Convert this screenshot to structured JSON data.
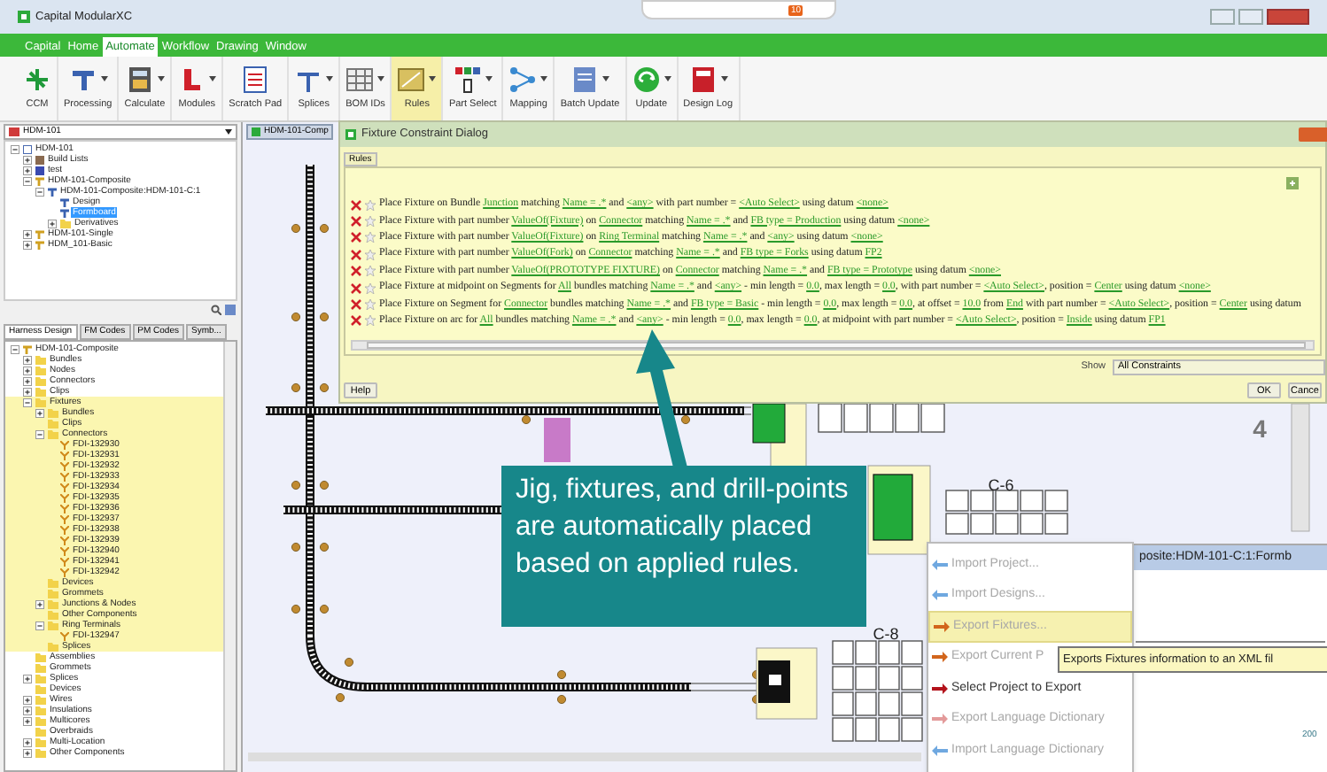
{
  "window": {
    "title": "Capital ModularXC",
    "badge": "10"
  },
  "menu": [
    {
      "label": "Capital",
      "selected": false
    },
    {
      "label": "Home",
      "selected": false
    },
    {
      "label": "Automate",
      "selected": true
    },
    {
      "label": "Workflow",
      "selected": false
    },
    {
      "label": "Drawing",
      "selected": false
    },
    {
      "label": "Window",
      "selected": false
    }
  ],
  "ribbon": [
    {
      "label": "CCM",
      "dropdown": false,
      "selected": false
    },
    {
      "label": "Processing",
      "dropdown": true,
      "selected": false
    },
    {
      "label": "Calculate",
      "dropdown": true,
      "selected": false
    },
    {
      "label": "Modules",
      "dropdown": true,
      "selected": false
    },
    {
      "label": "Scratch Pad",
      "dropdown": false,
      "selected": false
    },
    {
      "label": "Splices",
      "dropdown": true,
      "selected": false
    },
    {
      "label": "BOM IDs",
      "dropdown": true,
      "selected": false
    },
    {
      "label": "Rules",
      "dropdown": true,
      "selected": true
    },
    {
      "label": "Part Select",
      "dropdown": true,
      "selected": false
    },
    {
      "label": "Mapping",
      "dropdown": true,
      "selected": false
    },
    {
      "label": "Batch Update",
      "dropdown": true,
      "selected": false
    },
    {
      "label": "Update",
      "dropdown": true,
      "selected": false
    },
    {
      "label": "Design Log",
      "dropdown": true,
      "selected": false
    }
  ],
  "left_panel": {
    "dropdown": "HDM-101",
    "project_tree": [
      {
        "label": "HDM-101",
        "kind": "project",
        "expanded": true,
        "selected": false,
        "children": [
          {
            "label": "Build Lists",
            "kind": "list",
            "expanded": false,
            "selected": false
          },
          {
            "label": "test",
            "kind": "test",
            "expanded": false,
            "selected": false
          },
          {
            "label": "HDM-101-Composite",
            "kind": "harness",
            "expanded": true,
            "selected": false,
            "children": [
              {
                "label": "HDM-101-Composite:HDM-101-C:1",
                "kind": "design",
                "expanded": true,
                "selected": false,
                "children": [
                  {
                    "label": "Design",
                    "kind": "design",
                    "selected": false
                  },
                  {
                    "label": "Formboard",
                    "kind": "design",
                    "selected": true
                  },
                  {
                    "label": "Derivatives",
                    "kind": "folder",
                    "expanded": false,
                    "selected": false
                  }
                ]
              }
            ]
          },
          {
            "label": "HDM-101-Single",
            "kind": "harness",
            "expanded": false,
            "selected": false
          },
          {
            "label": "HDM_101-Basic",
            "kind": "harness",
            "expanded": false,
            "selected": false
          }
        ]
      }
    ],
    "tabs": [
      {
        "label": "Harness Design",
        "selected": true
      },
      {
        "label": "FM Codes",
        "selected": false
      },
      {
        "label": "PM Codes",
        "selected": false
      },
      {
        "label": "Symb...",
        "selected": false
      }
    ],
    "design_tree": [
      {
        "label": "HDM-101-Composite",
        "kind": "harness",
        "expanded": true,
        "highlighted": false,
        "children": [
          {
            "label": "Bundles",
            "kind": "folder",
            "expanded": false,
            "highlighted": false
          },
          {
            "label": "Nodes",
            "kind": "folder",
            "expanded": false,
            "highlighted": false
          },
          {
            "label": "Connectors",
            "kind": "folder",
            "expanded": false,
            "highlighted": false
          },
          {
            "label": "Clips",
            "kind": "folder",
            "expanded": false,
            "highlighted": false
          },
          {
            "label": "Fixtures",
            "kind": "folder",
            "expanded": true,
            "highlighted": true,
            "children": [
              {
                "label": "Bundles",
                "kind": "folder",
                "expanded": false
              },
              {
                "label": "Clips",
                "kind": "folder"
              },
              {
                "label": "Connectors",
                "kind": "folder",
                "expanded": true,
                "children": [
                  {
                    "label": "FDI-132930",
                    "kind": "fixture"
                  },
                  {
                    "label": "FDI-132931",
                    "kind": "fixture"
                  },
                  {
                    "label": "FDI-132932",
                    "kind": "fixture"
                  },
                  {
                    "label": "FDI-132933",
                    "kind": "fixture"
                  },
                  {
                    "label": "FDI-132934",
                    "kind": "fixture"
                  },
                  {
                    "label": "FDI-132935",
                    "kind": "fixture"
                  },
                  {
                    "label": "FDI-132936",
                    "kind": "fixture"
                  },
                  {
                    "label": "FDI-132937",
                    "kind": "fixture"
                  },
                  {
                    "label": "FDI-132938",
                    "kind": "fixture"
                  },
                  {
                    "label": "FDI-132939",
                    "kind": "fixture"
                  },
                  {
                    "label": "FDI-132940",
                    "kind": "fixture"
                  },
                  {
                    "label": "FDI-132941",
                    "kind": "fixture"
                  },
                  {
                    "label": "FDI-132942",
                    "kind": "fixture"
                  }
                ]
              },
              {
                "label": "Devices",
                "kind": "folder"
              },
              {
                "label": "Grommets",
                "kind": "folder"
              },
              {
                "label": "Junctions & Nodes",
                "kind": "folder",
                "expanded": false
              },
              {
                "label": "Other Components",
                "kind": "folder"
              },
              {
                "label": "Ring Terminals",
                "kind": "folder",
                "expanded": true,
                "children": [
                  {
                    "label": "FDI-132947",
                    "kind": "fixture"
                  }
                ]
              },
              {
                "label": "Splices",
                "kind": "folder"
              }
            ]
          },
          {
            "label": "Assemblies",
            "kind": "folder",
            "highlighted": false
          },
          {
            "label": "Grommets",
            "kind": "folder",
            "highlighted": false
          },
          {
            "label": "Splices",
            "kind": "folder",
            "expanded": false,
            "highlighted": false
          },
          {
            "label": "Devices",
            "kind": "folder",
            "highlighted": false
          },
          {
            "label": "Wires",
            "kind": "folder",
            "expanded": false,
            "highlighted": false
          },
          {
            "label": "Insulations",
            "kind": "folder",
            "expanded": false,
            "highlighted": false
          },
          {
            "label": "Multicores",
            "kind": "folder",
            "expanded": false,
            "highlighted": false
          },
          {
            "label": "Overbraids",
            "kind": "folder",
            "highlighted": false
          },
          {
            "label": "Multi-Location",
            "kind": "folder",
            "expanded": false,
            "highlighted": false
          },
          {
            "label": "Other Components",
            "kind": "folder",
            "expanded": false,
            "highlighted": false
          }
        ]
      }
    ]
  },
  "canvas": {
    "tab": "HDM-101-Comp",
    "labels": [
      "C-6",
      "C-8",
      "4"
    ]
  },
  "dialog": {
    "title": "Fixture Constraint Dialog",
    "tab": "Rules",
    "rules": [
      {
        "plain_then_link_parts": [
          "Place Fixture on Bundle ",
          "Junction",
          " matching ",
          "Name = .*",
          " and ",
          "<any>",
          " with part number = ",
          "<Auto Select>",
          " using datum ",
          "<none>"
        ]
      },
      {
        "plain_then_link_parts": [
          "Place Fixture with part number ",
          "ValueOf(Fixture)",
          " on ",
          "Connector",
          " matching ",
          "Name = .*",
          " and ",
          "FB type = Production",
          " using datum ",
          "<none>"
        ]
      },
      {
        "plain_then_link_parts": [
          "Place Fixture with part number ",
          "ValueOf(Fixture)",
          " on ",
          "Ring Terminal",
          " matching ",
          "Name = .*",
          " and ",
          "<any>",
          " using datum ",
          "<none>"
        ]
      },
      {
        "plain_then_link_parts": [
          "Place Fixture with part number ",
          "ValueOf(Fork)",
          " on ",
          "Connector",
          " matching ",
          "Name = .*",
          " and ",
          "FB type = Forks",
          " using datum ",
          "FP2"
        ]
      },
      {
        "plain_then_link_parts": [
          "Place Fixture with part number ",
          "ValueOf(PROTOTYPE FIXTURE)",
          " on ",
          "Connector",
          " matching ",
          "Name = .*",
          " and ",
          "FB type = Prototype",
          " using datum ",
          "<none>"
        ]
      },
      {
        "plain_then_link_parts": [
          "Place Fixture at midpoint on Segments for ",
          "All",
          " bundles matching ",
          "Name = .*",
          " and ",
          "<any>",
          " - min length = ",
          "0.0",
          ", max length = ",
          "0.0",
          ", with part number = ",
          "<Auto Select>",
          ", position = ",
          "Center",
          " using datum ",
          "<none>"
        ]
      },
      {
        "plain_then_link_parts": [
          "Place Fixture on Segment for ",
          "Connector",
          " bundles matching ",
          "Name = .*",
          " and ",
          "FB type = Basic",
          " - min length = ",
          "0.0",
          ", max length = ",
          "0.0",
          ", at offset = ",
          "10.0",
          " from ",
          "End",
          " with part number = ",
          "<Auto Select>",
          ", position = ",
          "Center",
          " using datum"
        ]
      },
      {
        "plain_then_link_parts": [
          "Place Fixture on arc for ",
          "All",
          " bundles matching ",
          "Name = .*",
          " and ",
          "<any>",
          " - min length = ",
          "0.0",
          ", max length = ",
          "0.0",
          ", at midpoint with part number = ",
          "<Auto Select>",
          ", position = ",
          "Inside",
          " using datum ",
          "FP1"
        ]
      }
    ],
    "show_label": "Show",
    "show_value": "All Constraints",
    "buttons": [
      "Help",
      "OK",
      "Cance"
    ]
  },
  "callout": {
    "text": "Jig, fixtures, and drill-points are automatically placed based on applied rules."
  },
  "background_window": {
    "title": "posite:HDM-101-C:1:Formb",
    "axis_label": "200"
  },
  "context_menu": [
    {
      "label": "Import Project...",
      "kind": "import",
      "color": "#6fa8e0",
      "disabled": true,
      "selected": false
    },
    {
      "label": "Import Designs...",
      "kind": "import",
      "color": "#6fa8e0",
      "disabled": true,
      "selected": false
    },
    {
      "label": "Export Fixtures...",
      "kind": "export",
      "color": "#d2651c",
      "disabled": true,
      "selected": true
    },
    {
      "label": "Export Current P",
      "kind": "export",
      "color": "#d2651c",
      "disabled": true,
      "selected": false
    },
    {
      "label": "Select Project to Export",
      "kind": "export",
      "color": "#b3121b",
      "disabled": false,
      "selected": false
    },
    {
      "label": "Export Language Dictionary",
      "kind": "export",
      "color": "#e39a9a",
      "disabled": true,
      "selected": false
    },
    {
      "label": "Import Language Dictionary",
      "kind": "import",
      "color": "#6fa8e0",
      "disabled": true,
      "selected": false
    }
  ],
  "tooltip": "Exports Fixtures information to an XML fil"
}
